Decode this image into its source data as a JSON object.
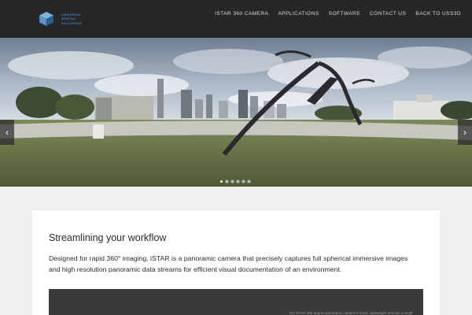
{
  "header": {
    "logo_text": [
      "UNIVERSAL",
      "SPATIAL",
      "SOLUTIONS"
    ],
    "nav": [
      "ISTAR 360 CAMERA",
      "APPLICATIONS",
      "SOFTWARE",
      "CONTACT US",
      "BACK TO USS3D"
    ]
  },
  "hero": {
    "prev_label": "‹",
    "next_label": "›",
    "slide_count": 6,
    "active_slide": 1
  },
  "content": {
    "heading": "Streamlining your workflow",
    "body": "Designed for rapid 360° imaging, iSTAR is a panoramic camera that precisely captures full spherical immersive images and high resolution panoramic data streams for efficient visual documentation of an environment.",
    "video_caption": "The iSTAR 360 degree panoramic camera is small, lightweight and has a small"
  },
  "colors": {
    "header_bg": "#272727",
    "logo_blue": "#3f7fb8",
    "page_bg": "#f0f0f0"
  }
}
